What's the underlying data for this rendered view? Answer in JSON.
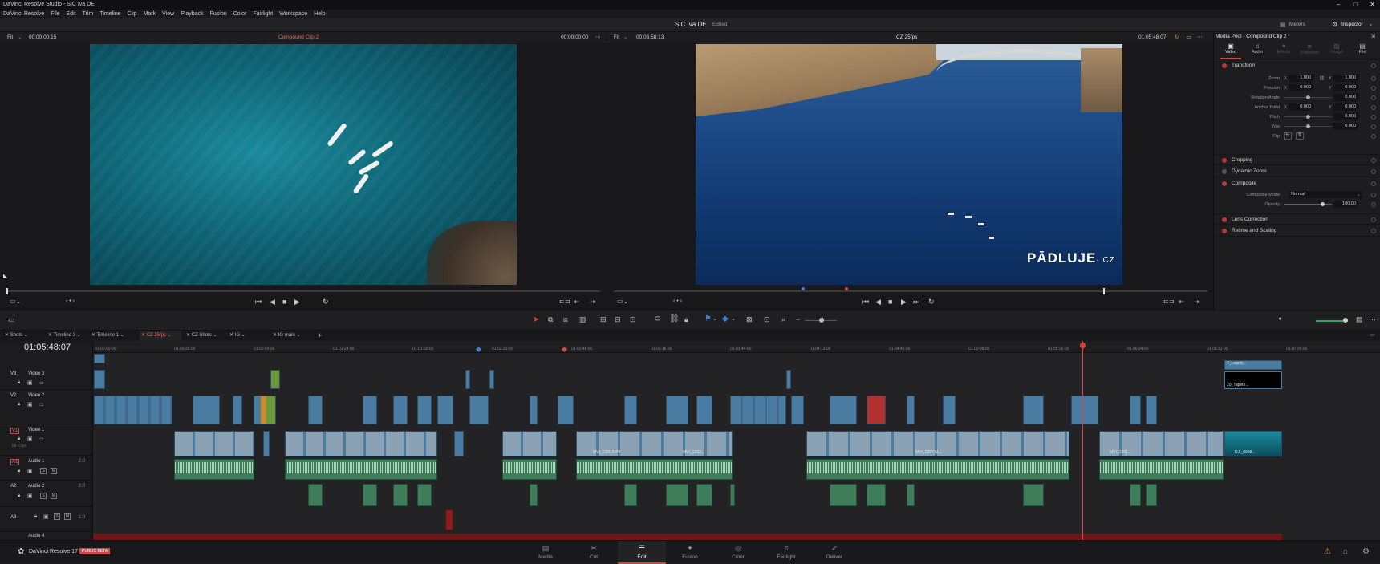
{
  "window": {
    "title": "DaVinci Resolve Studio - SIC Iva DE"
  },
  "menu": [
    "DaVinci Resolve",
    "File",
    "Edit",
    "Trim",
    "Timeline",
    "Clip",
    "Mark",
    "View",
    "Playback",
    "Fusion",
    "Color",
    "Fairlight",
    "Workspace",
    "Help"
  ],
  "header": {
    "project": "SIC Iva DE",
    "status": "Edited",
    "meters": "Meters",
    "inspector": "Inspector"
  },
  "source": {
    "zoom": "Fit",
    "timecode": "00:00:00:15",
    "clip": "Compound Clip 2",
    "duration": "00:00:00:00"
  },
  "program": {
    "zoom": "Fit",
    "timecode": "00:06:58:13",
    "timeline": "CZ 25fps",
    "position": "01:05:48:07"
  },
  "watermark": "PĀDLUJ",
  "watermark2": "E",
  "watermark_cz": "· CZ",
  "inspector": {
    "title": "Media Pool - Compound Clip 2",
    "tabs": [
      "Video",
      "Audio",
      "Effects",
      "Transition",
      "Image",
      "File"
    ],
    "sections": {
      "transform": "Transform",
      "cropping": "Cropping",
      "dynamic_zoom": "Dynamic Zoom",
      "composite": "Composite",
      "lens": "Lens Correction",
      "retime": "Retime and Scaling"
    },
    "zoom_label": "Zoom",
    "position_label": "Position",
    "rotation_label": "Rotation Angle",
    "anchor_label": "Anchor Point",
    "pitch_label": "Pitch",
    "yaw_label": "Yaw",
    "flip_label": "Flip",
    "zoom_x": "1.000",
    "zoom_y": "1.000",
    "pos_x": "0.000",
    "pos_y": "0.000",
    "rotation": "0.000",
    "anchor_x": "0.000",
    "anchor_y": "0.000",
    "pitch": "0.000",
    "yaw": "0.000",
    "composite_mode_label": "Composite Mode",
    "composite_mode": "Normal",
    "opacity_label": "Opacity",
    "opacity": "100.00",
    "x": "X",
    "y": "Y"
  },
  "timeline_tabs": [
    "Shots",
    "Timeline 3",
    "Timeline 1",
    "CZ 25fps",
    "CZ Shots",
    "IG",
    "IG main"
  ],
  "timecode": "01:05:48:07",
  "ruler": [
    "01:00:00:00",
    "01:00:28:00",
    "01:00:56:00",
    "01:01:24:00",
    "01:01:52:00",
    "01:02:20:00",
    "01:02:48:00",
    "01:03:16:00",
    "01:03:44:00",
    "01:04:12:00",
    "01:04:40:00",
    "01:05:08:00",
    "01:05:36:00",
    "01:06:04:00",
    "01:06:32:00",
    "01:07:00:00"
  ],
  "tracks": {
    "v3": {
      "id": "V3",
      "name": "Video 3"
    },
    "v2": {
      "id": "V2",
      "name": "Video 2"
    },
    "v1": {
      "id": "V1",
      "name": "Video 1",
      "clips": "88 Clips"
    },
    "a1": {
      "id": "A1",
      "name": "Audio 1",
      "ch": "2.0"
    },
    "a2": {
      "id": "A2",
      "name": "Audio 2",
      "ch": "2.0"
    },
    "a3": {
      "id": "A3",
      "ch": "2.0"
    },
    "a4": {
      "name": "Audio 4"
    }
  },
  "clips": {
    "logo": "7_Logoty...",
    "tapeta": "20_Tapete...",
    "dji": "DJI_0058...",
    "mvi1250": "MVI_1250.MP4",
    "mvi1253": "MVI_1253...",
    "mvi1257": "MVI_1257.M...",
    "mvi1261": "MVI_1261..."
  },
  "pages": [
    "Media",
    "Cut",
    "Edit",
    "Fusion",
    "Color",
    "Fairlight",
    "Deliver"
  ],
  "footer": {
    "app": "DaVinci Resolve 17",
    "badge": "PUBLIC BETA"
  }
}
